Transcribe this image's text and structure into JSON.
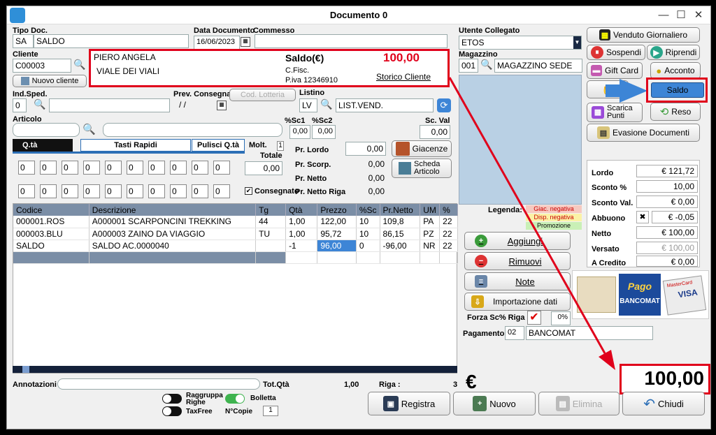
{
  "window": {
    "title": "Documento 0",
    "minimize": "—",
    "maximize": "☐",
    "close": "✕"
  },
  "header": {
    "tipo_doc_label": "Tipo Doc.",
    "tipo_doc_code": "SA",
    "tipo_doc_value": "SALDO",
    "data_label": "Data Documento",
    "data_value": "16/06/2023",
    "commesso_label": "Commesso",
    "commesso_value": "",
    "utente_label": "Utente Collegato",
    "utente_value": "ETOS",
    "cliente_label": "Cliente",
    "cliente_value": "C00003",
    "nuovo_cliente": "Nuovo cliente",
    "magazzino_label": "Magazzino",
    "magazzino_code": "001",
    "magazzino_value": "MAGAZZINO SEDE"
  },
  "customer": {
    "name": "PIERO ANGELA",
    "address": "VIALE DEI VIALI",
    "saldo_label": "Saldo(€)",
    "saldo_value": "100,00",
    "cf_label": "C.Fisc.",
    "piva": "P.iva 12346910",
    "storico": "Storico Cliente"
  },
  "shipping": {
    "ind_sped_label": "Ind.Sped.",
    "ind_sped_value": "0",
    "prev_label": "Prev. Consegna",
    "prev_value": "/  /",
    "lotteria": "Cod. Lotteria",
    "listino_label": "Listino",
    "listino_code": "LV",
    "listino_value": "LIST.VEND."
  },
  "articolo": {
    "label": "Articolo",
    "sc1_label": "%Sc1",
    "sc1": "0,00",
    "sc2_label": "%Sc2",
    "sc2": "0,00",
    "scval_label": "Sc. Val",
    "scval": "0,00"
  },
  "qty": {
    "tab_qta": "Q.tà",
    "tab_rapidi": "Tasti Rapidi",
    "tab_pulisci": "Pulisci Q.tà",
    "molt_label": "Molt.",
    "molt_value": "1",
    "totale_label": "Totale",
    "totale_value": "0,00",
    "consegnato": "Consegnato",
    "row1": [
      "0",
      "0",
      "0",
      "0",
      "0",
      "0",
      "0",
      "0",
      "0",
      "0"
    ],
    "row2": [
      "0",
      "0",
      "0",
      "0",
      "0",
      "0",
      "0",
      "0",
      "0",
      "0"
    ]
  },
  "prices": {
    "lordo_label": "Pr. Lordo",
    "lordo": "0,00",
    "scorp_label": "Pr. Scorp.",
    "scorp": "0,00",
    "netto_label": "Pr. Netto",
    "netto": "0,00",
    "riga_label": "Pr. Netto Riga",
    "riga": "0,00",
    "giacenze": "Giacenze",
    "scheda": "Scheda Articolo"
  },
  "table": {
    "headers": [
      "Codice",
      "Descrizione",
      "Tg",
      "Qtà",
      "Prezzo",
      "%Sc",
      "Pr.Netto",
      "UM",
      "%"
    ],
    "rows": [
      [
        "000001.ROS",
        "A000001 SCARPONCINI TREKKING",
        "44",
        "1,00",
        "122,00",
        "10",
        "109,8",
        "PA",
        "22"
      ],
      [
        "000003.BLU",
        "A000003 ZAINO DA VIAGGIO",
        "TU",
        "1,00",
        "95,72",
        "10",
        "86,15",
        "PZ",
        "22"
      ],
      [
        "SALDO",
        "SALDO AC.0000040",
        "",
        "-1",
        "96,00",
        "0",
        "-96,00",
        "NR",
        "22"
      ]
    ]
  },
  "legend": {
    "label": "Legenda:",
    "giac": "Giac. negativa",
    "disp": "Disp. negativa",
    "promo": "Promozione"
  },
  "actions": {
    "aggiungi": "Aggiungi",
    "rimuovi": "Rimuovi",
    "note": "Note",
    "importazione": "Importazione dati",
    "forza_label": "Forza Sc% Riga",
    "forza_pct": "0%",
    "pagamento_label": "Pagamento",
    "pagamento_code": "02",
    "pagamento_value": "BANCOMAT"
  },
  "side": {
    "venduto": "Venduto Giornaliero",
    "sospendi": "Sospendi",
    "riprendi": "Riprendi",
    "giftcard": "Gift Card",
    "acconto": "Acconto",
    "saldo": "Saldo",
    "scarica": "Scarica Punti",
    "reso": "Reso",
    "evasione": "Evasione Documenti"
  },
  "totals": {
    "lordo_label": "Lordo",
    "lordo": "€ 121,72",
    "sconto_pct_label": "Sconto %",
    "sconto_pct": "10,00",
    "sconto_val_label": "Sconto Val.",
    "sconto_val": "€ 0,00",
    "abbuono_label": "Abbuono",
    "abbuono": "€ -0,05",
    "netto_label": "Netto",
    "netto": "€ 100,00",
    "versato_label": "Versato",
    "versato": "€ 100,00",
    "credito_label": "A Credito",
    "credito": "€ 0,00"
  },
  "payment": {
    "pago": "Pago",
    "bancomat": "BANCOMAT",
    "visa": "VISA",
    "mastercard": "MasterCard"
  },
  "footer": {
    "annotazioni_label": "Annotazioni",
    "tot_qta_label": "Tot.Qtà",
    "tot_qta": "1,00",
    "riga_label": "Riga :",
    "riga": "3",
    "raggruppa": "Raggruppa Righe",
    "bolletta": "Bolletta",
    "taxfree": "TaxFree",
    "ncopie_label": "N°Copie",
    "ncopie": "1",
    "euro": "€",
    "total": "100,00",
    "registra": "Registra",
    "nuovo": "Nuovo",
    "elimina": "Elimina",
    "chiudi": "Chiudi"
  },
  "colors": {
    "accent_red": "#e0001b",
    "arrow_blue": "#3d85d6",
    "grid_header": "#7b8ea6"
  }
}
